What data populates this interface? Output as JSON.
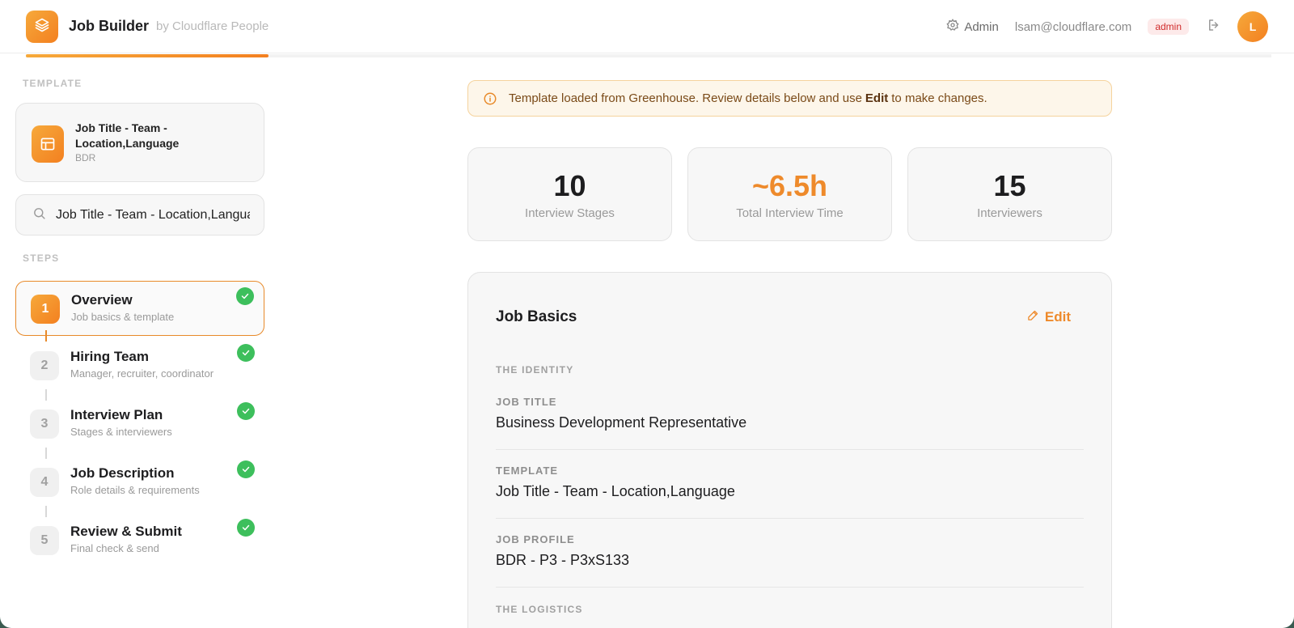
{
  "header": {
    "app_title": "Job Builder",
    "subtitle": "by Cloudflare People",
    "admin_label": "Admin",
    "email": "lsam@cloudflare.com",
    "role_badge": "admin",
    "avatar_initial": "L",
    "progress_fraction": 0.195,
    "accent_color": "#f38020"
  },
  "sidebar": {
    "template_section_label": "TEMPLATE",
    "template": {
      "name": "Job Title - Team - Location,Language",
      "sub": "BDR"
    },
    "search": {
      "value": "Job Title - Team - Location,Language",
      "placeholder": ""
    },
    "steps_section_label": "STEPS",
    "steps": [
      {
        "num": "1",
        "title": "Overview",
        "sub": "Job basics & template",
        "complete": true,
        "active": true
      },
      {
        "num": "2",
        "title": "Hiring Team",
        "sub": "Manager, recruiter, coordinator",
        "complete": true,
        "active": false
      },
      {
        "num": "3",
        "title": "Interview Plan",
        "sub": "Stages & interviewers",
        "complete": true,
        "active": false
      },
      {
        "num": "4",
        "title": "Job Description",
        "sub": "Role details & requirements",
        "complete": true,
        "active": false
      },
      {
        "num": "5",
        "title": "Review & Submit",
        "sub": "Final check & send",
        "complete": true,
        "active": false
      }
    ]
  },
  "banner": {
    "text_before": "Template loaded from Greenhouse. Review details below and use",
    "bold": "Edit",
    "text_after": "to make changes."
  },
  "stats": [
    {
      "value": "10",
      "label": "Interview Stages"
    },
    {
      "value": "~6.5h",
      "label": "Total Interview Time"
    },
    {
      "value": "15",
      "label": "Interviewers"
    }
  ],
  "job_basics": {
    "title": "Job Basics",
    "edit_label": "Edit",
    "identity_label": "THE IDENTITY",
    "job_title_label": "JOB TITLE",
    "job_title_value": "Business Development Representative",
    "template_label": "TEMPLATE",
    "template_value": "Job Title - Team - Location,Language",
    "job_profile_label": "JOB PROFILE",
    "job_profile_value": "BDR - P3 - P3xS133",
    "logistics_label": "THE LOGISTICS"
  }
}
